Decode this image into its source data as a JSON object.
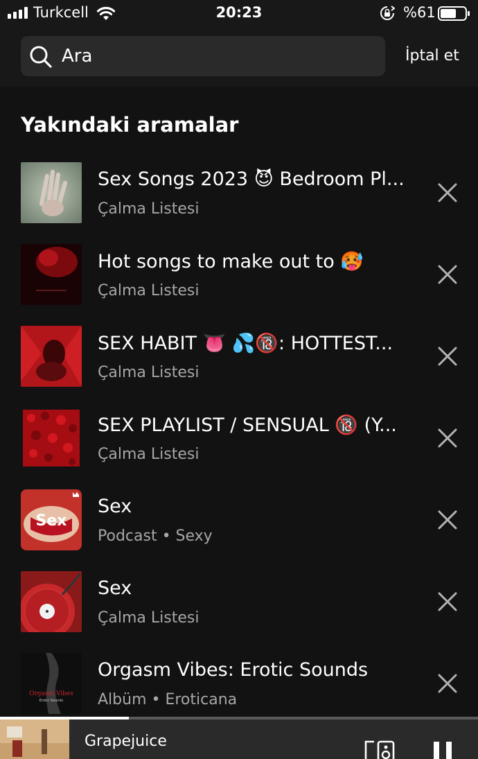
{
  "status_bar": {
    "carrier": "Turkcell",
    "time": "20:23",
    "battery": "%61",
    "icons": [
      "signal-icon",
      "wifi-icon",
      "orientation-lock-icon",
      "battery-icon"
    ]
  },
  "search": {
    "placeholder": "Ara",
    "cancel_label": "İptal et"
  },
  "section": {
    "title": "Yakındaki aramalar"
  },
  "items": [
    {
      "title": "Sex Songs 2023 😈 Bedroom Pl...",
      "subtitle": "Çalma Listesi"
    },
    {
      "title": "Hot songs to make out to 🥵",
      "subtitle": "Çalma Listesi"
    },
    {
      "title": "SEX HABIT 👅 💦🔞: HOTTEST...",
      "subtitle": "Çalma Listesi"
    },
    {
      "title": "SEX PLAYLIST / SENSUAL 🔞 (Y...",
      "subtitle": "Çalma Listesi"
    },
    {
      "title": "Sex",
      "subtitle": "Podcast • Sexy",
      "art_text": "Sex"
    },
    {
      "title": "Sex",
      "subtitle": "Çalma Listesi"
    },
    {
      "title": "Orgasm Vibes: Erotic Sounds",
      "subtitle": "Albüm • Eroticana",
      "art_text": "Orgasm Vibes",
      "art_subtext": "Erotic Sounds"
    }
  ],
  "player": {
    "track": "Grapejuice",
    "progress": 0.27
  },
  "colors": {
    "background": "#121212",
    "header": "#181818",
    "search_box": "#2a2a2a",
    "secondary_text": "#a7a7a7"
  }
}
